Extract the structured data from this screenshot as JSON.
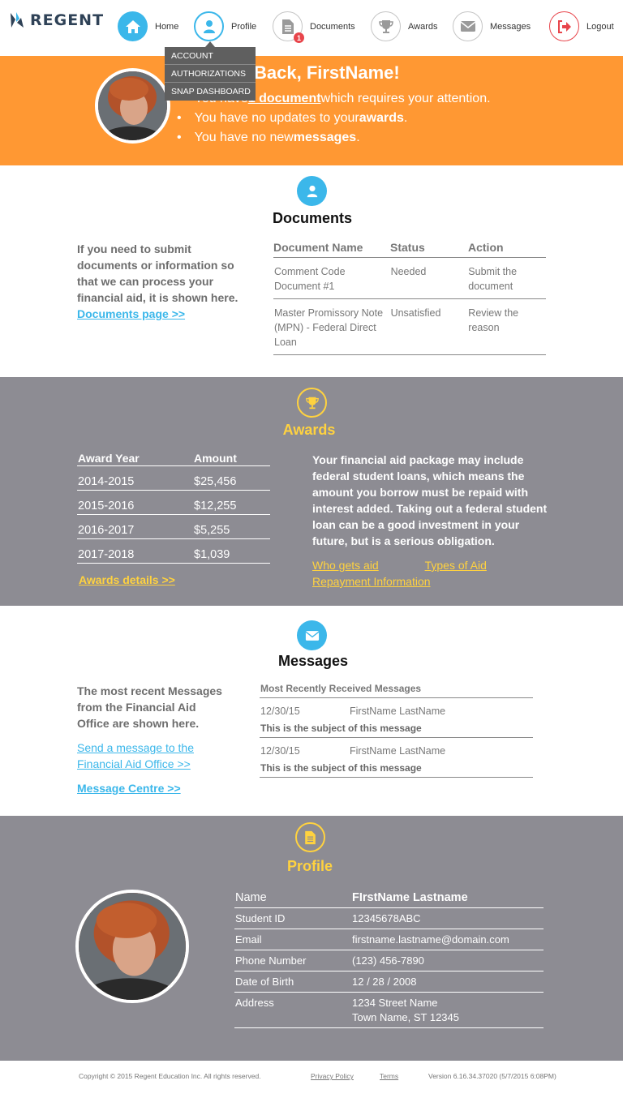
{
  "brand": {
    "name": "REGENT"
  },
  "nav": {
    "items": [
      {
        "label": "Home",
        "icon": "home-icon"
      },
      {
        "label": "Profile",
        "icon": "user-icon"
      },
      {
        "label": "Documents",
        "icon": "document-icon",
        "badge": "1"
      },
      {
        "label": "Awards",
        "icon": "trophy-icon"
      },
      {
        "label": "Messages",
        "icon": "envelope-icon"
      },
      {
        "label": "Logout",
        "icon": "logout-icon"
      }
    ],
    "profile_menu": [
      "ACCOUNT",
      "AUTHORIZATIONS",
      "SNAP DASHBOARD"
    ]
  },
  "hero": {
    "title": "Back, FirstName!",
    "line1_pre": "You have ",
    "line1_link": "1 document",
    "line1_post": " which requires your attention.",
    "line2_pre": "You have no updates to your ",
    "line2_bold": "awards",
    "line2_post": ".",
    "line3_pre": "You have no new ",
    "line3_bold": "messages",
    "line3_post": "."
  },
  "documents": {
    "title": "Documents",
    "intro": "If you need to submit documents or information so that we can process your financial aid, it is shown here.",
    "link": "Documents page >>",
    "headers": [
      "Document Name",
      "Status",
      "Action"
    ],
    "rows": [
      [
        "Comment Code Document #1",
        "Needed",
        "Submit the document"
      ],
      [
        "Master Promissory Note (MPN) - Federal Direct Loan",
        "Unsatisfied",
        "Review the reason"
      ]
    ]
  },
  "awards": {
    "title": "Awards",
    "headers": [
      "Award Year",
      "Amount"
    ],
    "rows": [
      [
        "2014-2015",
        "$25,456"
      ],
      [
        "2015-2016",
        "$12,255"
      ],
      [
        "2016-2017",
        "$5,255"
      ],
      [
        "2017-2018",
        "$1,039"
      ]
    ],
    "details_link": "Awards details >>",
    "info": "Your financial aid package may include federal student loans, which means the amount you borrow must be repaid with interest added. Taking out a federal student loan can be a good investment in your future, but is a serious obligation.",
    "links": [
      "Who gets aid",
      "Types of Aid",
      "Repayment Information"
    ]
  },
  "messages": {
    "title": "Messages",
    "intro": "The most recent Messages from the Financial Aid Office are shown here.",
    "send_link": "Send a message to the Financial Aid Office >>",
    "centre_link": "Message Centre >>",
    "header": "Most Recently Received Messages",
    "rows": [
      {
        "date": "12/30/15",
        "from": "FirstName LastName",
        "subject": "This is the subject of this message"
      },
      {
        "date": "12/30/15",
        "from": "FirstName LastName",
        "subject": "This is the subject of this message"
      }
    ]
  },
  "profile": {
    "title": "Profile",
    "rows": [
      [
        "Name",
        "FIrstName Lastname"
      ],
      [
        "Student ID",
        "12345678ABC"
      ],
      [
        "Email",
        "firstname.lastname@domain.com"
      ],
      [
        "Phone Number",
        "(123) 456-7890"
      ],
      [
        "Date of Birth",
        "12 / 28 / 2008"
      ],
      [
        "Address",
        "1234 Street Name",
        "Town Name, ST 12345"
      ]
    ]
  },
  "footer": {
    "copyright": "Copyright © 2015 Regent Education Inc. All rights reserved.",
    "privacy": "Privacy Policy",
    "terms": "Terms",
    "version": "Version 6.16.34.37020 (5/7/2015 6:08PM)"
  },
  "colors": {
    "accent_blue": "#3bb7ea",
    "orange": "#ff9833",
    "gray_band": "#8d8c93",
    "yellow": "#ffd23f",
    "logout_red": "#e8454b"
  }
}
